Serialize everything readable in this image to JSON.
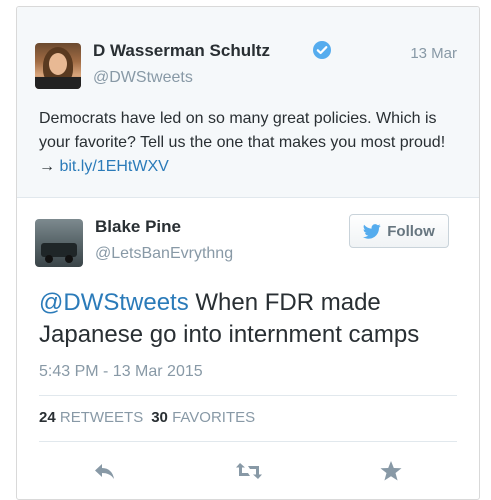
{
  "parent_tweet": {
    "name": "D Wasserman Schultz",
    "handle": "@DWStweets",
    "date": "13 Mar",
    "text": "Democrats have led on so many great policies. Which is your favorite? Tell us the one that makes you most proud! → ",
    "link": "bit.ly/1EHtWXV"
  },
  "main_tweet": {
    "name": "Blake Pine",
    "handle": "@LetsBanEvrythng",
    "follow_label": "Follow",
    "mention": "@DWStweets",
    "text": " When FDR made Japanese go into internment camps",
    "timestamp": "5:43 PM - 13 Mar 2015",
    "retweets_count": "24",
    "retweets_label": "RETWEETS",
    "favorites_count": "30",
    "favorites_label": "FAVORITES"
  },
  "icons": {
    "reply": "reply-icon",
    "retweet": "retweet-icon",
    "favorite": "star-icon",
    "verified": "verified-badge-icon",
    "follow_bird": "twitter-bird-icon"
  },
  "colors": {
    "link": "#2b7bb9",
    "muted": "#8899a6",
    "verified": "#55acee",
    "twitter_blue": "#55acee"
  }
}
